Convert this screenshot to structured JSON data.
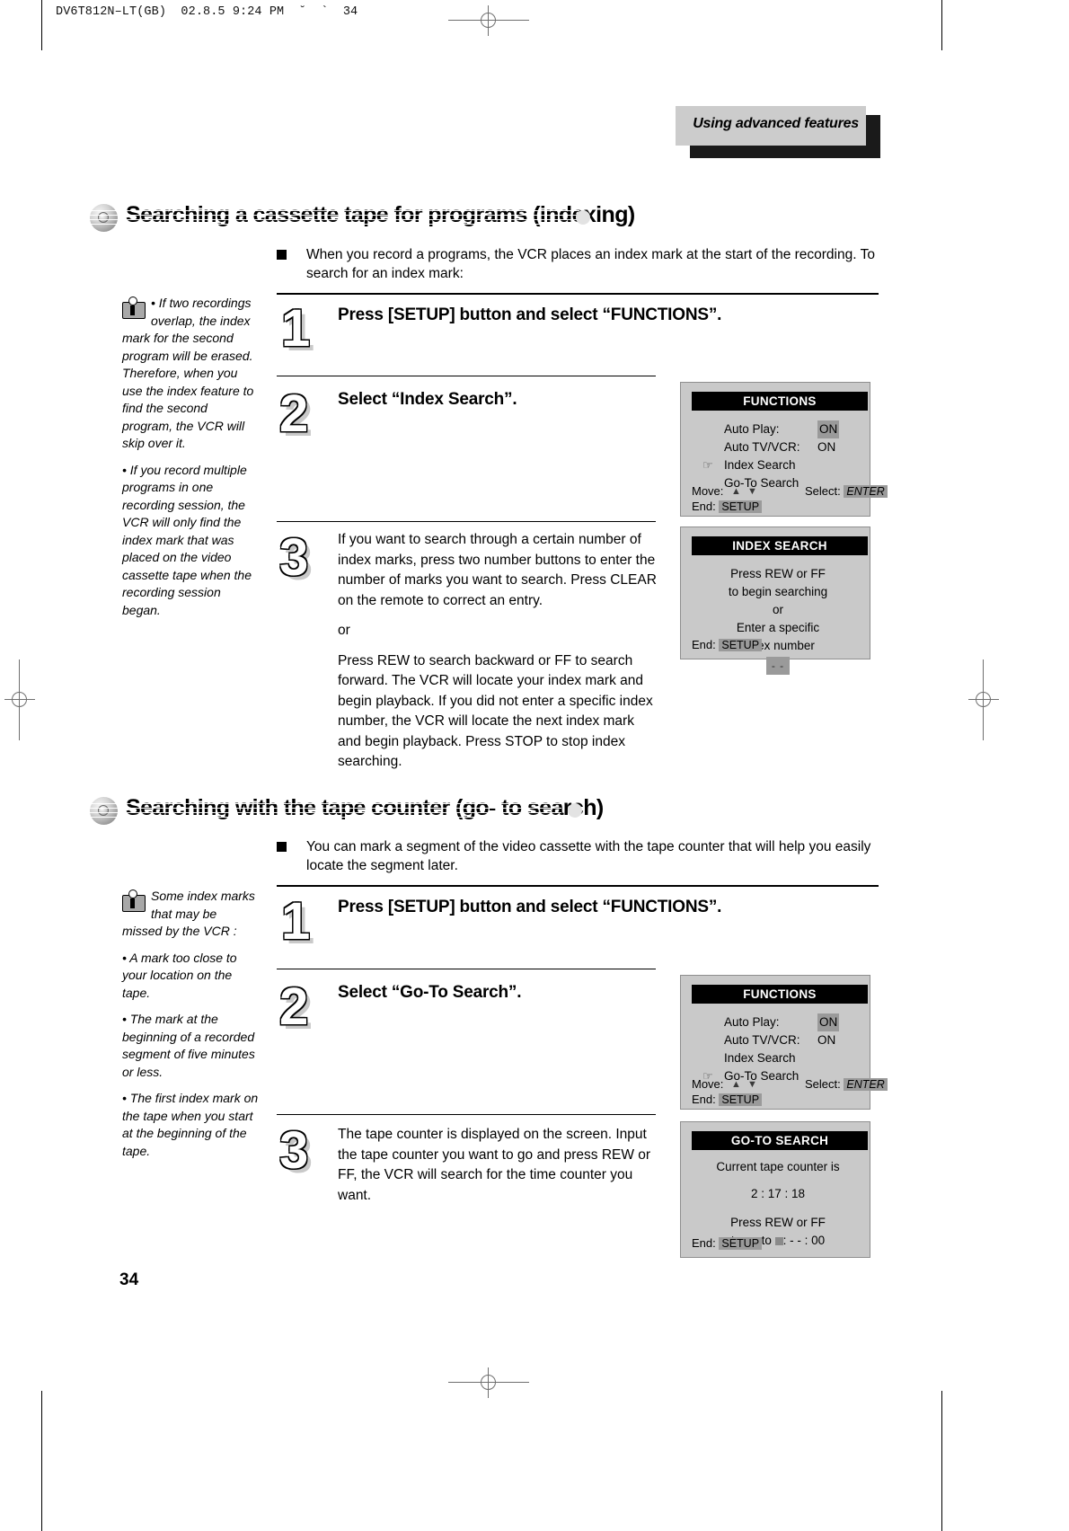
{
  "print_slug": "DV6T812N–LT(GB)  02.8.5 9:24 PM  ˘  `  34",
  "chapter_tab": {
    "label": "Using advanced features"
  },
  "page_number": "34",
  "sections": [
    {
      "title": "Searching a cassette tape for programs (indexing)",
      "intro": "When you record a programs, the VCR places an index mark at the start of the recording. To search for an index mark:",
      "note": {
        "icon": "info-icon",
        "paragraphs": [
          "• If two recordings overlap, the index mark for the second program will be erased. Therefore, when you use the index feature to find the second program, the VCR will skip over it.",
          "• If you record multiple programs in one recording session, the VCR will only find the index mark that was placed on the video cassette tape when the recording session began."
        ]
      },
      "steps": [
        {
          "number": "1",
          "title": "Press [SETUP] button and select “FUNCTIONS”.",
          "body": []
        },
        {
          "number": "2",
          "title": "Select “Index Search”.",
          "body": []
        },
        {
          "number": "3",
          "title": "",
          "body": [
            "If you want to search through a certain number of index marks, press two number buttons to enter the number of marks you want to search. Press CLEAR on the remote to correct an entry.",
            "or",
            "Press REW to search backward or FF to search forward. The VCR will locate your index mark and begin playback. If you did not enter a specific index number, the VCR will locate the next index mark and begin playback. Press STOP to stop index searching."
          ]
        }
      ]
    },
    {
      "title": "Searching with the tape counter (go- to search)",
      "intro": "You can mark a segment of the video cassette with the tape counter that will help you easily locate the segment later.",
      "note": {
        "icon": "info-icon",
        "paragraphs": [
          "Some index marks  that may be missed by the VCR :",
          "• A mark too close to your location on the tape.",
          "• The mark at the beginning of a recorded segment of five minutes or less.",
          "• The first index mark on the tape when you start at the beginning of the tape."
        ]
      },
      "steps": [
        {
          "number": "1",
          "title": "Press [SETUP] button and select “FUNCTIONS”.",
          "body": []
        },
        {
          "number": "2",
          "title": "Select “Go-To Search”.",
          "body": []
        },
        {
          "number": "3",
          "title": "",
          "body": [
            "The tape counter is displayed on the screen. Input the tape counter you want to go and press REW or FF, the VCR will search for the time counter you want."
          ]
        }
      ]
    }
  ],
  "osd_screens": [
    {
      "id": "functions-index",
      "title": "FUNCTIONS",
      "rows": [
        {
          "pointer": false,
          "name": "Auto Play:",
          "value": "ON",
          "value_highlight": true
        },
        {
          "pointer": false,
          "name": "Auto TV/VCR:",
          "value": "ON",
          "value_highlight": false
        },
        {
          "pointer": true,
          "name": "Index Search",
          "value": "",
          "value_highlight": false
        },
        {
          "pointer": false,
          "name": "Go-To Search",
          "value": "",
          "value_highlight": false
        }
      ],
      "footer": {
        "move_label": "Move:",
        "move_arrows": "▲ ▼",
        "select_label": "Select:",
        "select_key": "ENTER",
        "end_label": "End:",
        "end_key": "SETUP"
      }
    },
    {
      "id": "index-search",
      "title": "INDEX SEARCH",
      "lines": [
        "Press REW or FF",
        "to begin searching",
        "or",
        "Enter a specific",
        "index number"
      ],
      "entry_field": "- -",
      "footer": {
        "end_label": "End:",
        "end_key": "SETUP"
      }
    },
    {
      "id": "functions-goto",
      "title": "FUNCTIONS",
      "rows": [
        {
          "pointer": false,
          "name": "Auto Play:",
          "value": "ON",
          "value_highlight": true
        },
        {
          "pointer": false,
          "name": "Auto TV/VCR:",
          "value": "ON",
          "value_highlight": false
        },
        {
          "pointer": false,
          "name": "Index Search",
          "value": "",
          "value_highlight": false
        },
        {
          "pointer": true,
          "name": "Go-To Search",
          "value": "",
          "value_highlight": false
        }
      ],
      "footer": {
        "move_label": "Move:",
        "move_arrows": "▲ ▼",
        "select_label": "Select:",
        "select_key": "ENTER",
        "end_label": "End:",
        "end_key": "SETUP"
      }
    },
    {
      "id": "go-to-search",
      "title": "GO-TO SEARCH",
      "lines": [
        "Current tape counter is",
        "2 : 17 : 18",
        "Press REW or FF",
        "to go to"
      ],
      "goto_value": ": - - : 00",
      "footer": {
        "end_label": "End:",
        "end_key": "SETUP"
      }
    }
  ]
}
